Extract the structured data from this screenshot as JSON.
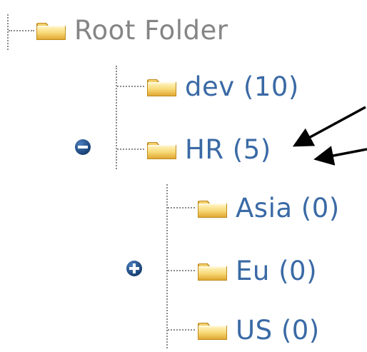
{
  "tree": {
    "root": {
      "label": "Root Folder",
      "icon": "folder-icon"
    },
    "items": [
      {
        "label": "dev (10)",
        "icon": "folder-icon"
      },
      {
        "label": "HR (5)",
        "icon": "folder-icon",
        "expanded": true,
        "toggle_icon": "collapse-minus-icon"
      },
      {
        "label": "Asia (0)",
        "icon": "folder-icon"
      },
      {
        "label": "Eu (0)",
        "icon": "folder-icon",
        "expanded": false,
        "toggle_icon": "expand-plus-icon"
      },
      {
        "label": "US (0)",
        "icon": "folder-icon"
      }
    ]
  },
  "colors": {
    "root_text": "#858585",
    "child_text": "#3a6aa5",
    "folder_light": "#fbe49a",
    "folder_dark": "#e0a832",
    "toggle_fill": "#1f4f8a",
    "connector": "#8a8a8a",
    "arrow": "#000000"
  }
}
